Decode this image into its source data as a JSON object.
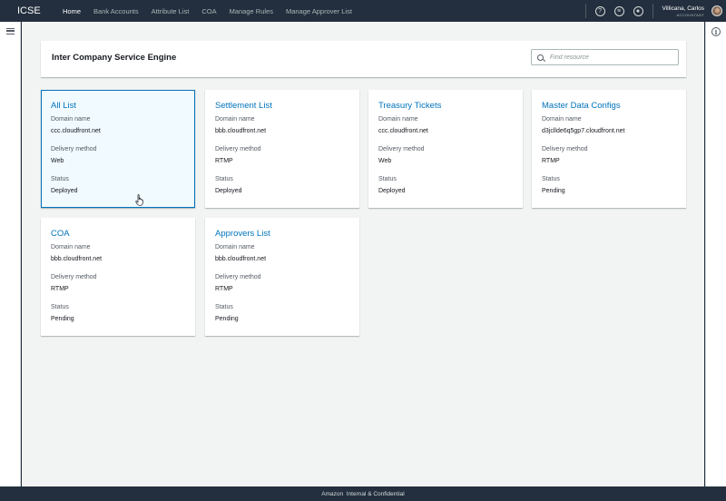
{
  "app": {
    "brand": "ICSE"
  },
  "nav": [
    {
      "label": "Home",
      "active": true
    },
    {
      "label": "Bank Accounts",
      "active": false
    },
    {
      "label": "Attribute List",
      "active": false
    },
    {
      "label": "COA",
      "active": false
    },
    {
      "label": "Manage Rules",
      "active": false
    },
    {
      "label": "Manage Approver List",
      "active": false
    }
  ],
  "header_icons": [
    "help-icon",
    "feedback-icon",
    "user-settings-icon"
  ],
  "user": {
    "name": "Villicana, Carlos",
    "role": "ACCOUNTANT"
  },
  "page": {
    "title": "Inter Company Service Engine",
    "search_placeholder": "Find resource"
  },
  "field_labels": {
    "domain": "Domain name",
    "delivery": "Delivery method",
    "status": "Status"
  },
  "cards": [
    {
      "title": "All List",
      "domain": "ccc.cloudfront.net",
      "delivery": "Web",
      "status": "Deployed",
      "selected": true
    },
    {
      "title": "Settlement List",
      "domain": "bbb.cloudfront.net",
      "delivery": "RTMP",
      "status": "Deployed",
      "selected": false
    },
    {
      "title": "Treasury Tickets",
      "domain": "ccc.cloudfront.net",
      "delivery": "Web",
      "status": "Deployed",
      "selected": false
    },
    {
      "title": "Master Data Configs",
      "domain": "d3jcllde6q5gp7.cloudfront.net",
      "delivery": "RTMP",
      "status": "Pending",
      "selected": false
    },
    {
      "title": "COA",
      "domain": "bbb.cloudfront.net",
      "delivery": "RTMP",
      "status": "Pending",
      "selected": false
    },
    {
      "title": "Approvers List",
      "domain": "bbb.cloudfront.net",
      "delivery": "RTMP",
      "status": "Pending",
      "selected": false
    }
  ],
  "footer": {
    "text": "Amazon  Internal & Confidential"
  },
  "colors": {
    "topbar": "#232f3e",
    "link": "#0073bb",
    "selected_bg": "#f1faff",
    "page_bg": "#f2f3f3"
  }
}
